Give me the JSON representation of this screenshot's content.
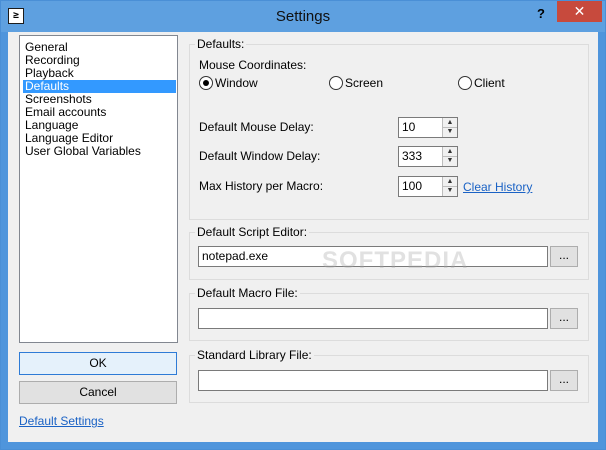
{
  "window": {
    "title": "Settings",
    "help_label": "?",
    "close_label": "✕",
    "app_icon_glyph": "≥"
  },
  "sidebar": {
    "items": [
      {
        "label": "General"
      },
      {
        "label": "Recording"
      },
      {
        "label": "Playback"
      },
      {
        "label": "Defaults",
        "selected": true
      },
      {
        "label": "Screenshots"
      },
      {
        "label": "Email accounts"
      },
      {
        "label": "Language"
      },
      {
        "label": "Language Editor"
      },
      {
        "label": "User Global Variables"
      }
    ]
  },
  "buttons": {
    "ok": "OK",
    "cancel": "Cancel",
    "default_settings": "Default Settings"
  },
  "defaults": {
    "group_title": "Defaults:",
    "mouse_coords_label": "Mouse Coordinates:",
    "radio_window": "Window",
    "radio_screen": "Screen",
    "radio_client": "Client",
    "mouse_delay_label": "Default Mouse Delay:",
    "mouse_delay_value": "10",
    "window_delay_label": "Default Window Delay:",
    "window_delay_value": "333",
    "max_history_label": "Max History per Macro:",
    "max_history_value": "100",
    "clear_history": "Clear History"
  },
  "script_editor": {
    "title": "Default Script Editor:",
    "value": "notepad.exe",
    "browse": "..."
  },
  "macro_file": {
    "title": "Default Macro File:",
    "value": "",
    "browse": "..."
  },
  "library_file": {
    "title": "Standard Library File:",
    "value": "",
    "browse": "..."
  },
  "watermark": "SOFTPEDIA",
  "spin": {
    "up": "▲",
    "down": "▼"
  }
}
